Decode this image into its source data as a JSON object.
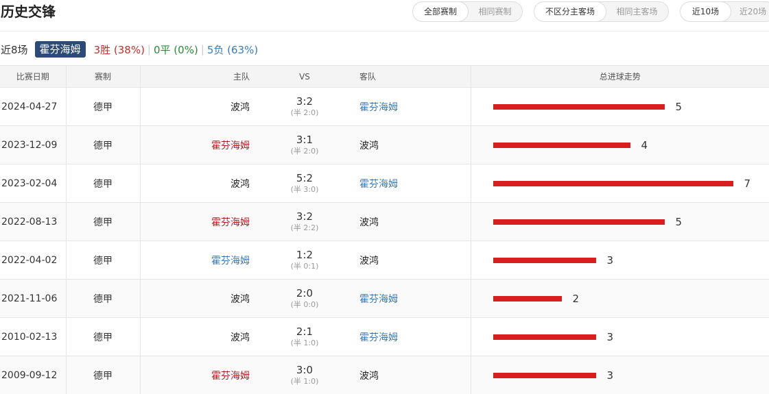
{
  "header": {
    "title": "历史交锋",
    "filters": [
      {
        "options": [
          "全部赛制",
          "相同赛制"
        ],
        "active": 0
      },
      {
        "options": [
          "不区分主客场",
          "相同主客场"
        ],
        "active": 0
      },
      {
        "options": [
          "近10场",
          "近20场"
        ],
        "active": 0
      }
    ]
  },
  "summary": {
    "near": "近8场",
    "team": "霍芬海姆",
    "win": "3胜 (38%)",
    "draw": "0平 (0%)",
    "lose": "5负 (63%)",
    "sep": "|"
  },
  "table": {
    "headers": [
      "比赛日期",
      "赛制",
      "主队",
      "VS",
      "客队",
      "总进球走势"
    ],
    "max_goals": 7,
    "rows": [
      {
        "date": "2024-04-27",
        "comp": "德甲",
        "home": "波鸿",
        "home_style": "plain",
        "score": "3:2",
        "half": "(半 2:0)",
        "away": "霍芬海姆",
        "away_style": "blue",
        "goals": 5
      },
      {
        "date": "2023-12-09",
        "comp": "德甲",
        "home": "霍芬海姆",
        "home_style": "red",
        "score": "3:1",
        "half": "(半 2:0)",
        "away": "波鸿",
        "away_style": "plain",
        "goals": 4
      },
      {
        "date": "2023-02-04",
        "comp": "德甲",
        "home": "波鸿",
        "home_style": "plain",
        "score": "5:2",
        "half": "(半 3:0)",
        "away": "霍芬海姆",
        "away_style": "blue",
        "goals": 7
      },
      {
        "date": "2022-08-13",
        "comp": "德甲",
        "home": "霍芬海姆",
        "home_style": "red",
        "score": "3:2",
        "half": "(半 2:2)",
        "away": "波鸿",
        "away_style": "plain",
        "goals": 5
      },
      {
        "date": "2022-04-02",
        "comp": "德甲",
        "home": "霍芬海姆",
        "home_style": "blue",
        "score": "1:2",
        "half": "(半 0:1)",
        "away": "波鸿",
        "away_style": "plain",
        "goals": 3
      },
      {
        "date": "2021-11-06",
        "comp": "德甲",
        "home": "波鸿",
        "home_style": "plain",
        "score": "2:0",
        "half": "(半 0:0)",
        "away": "霍芬海姆",
        "away_style": "blue",
        "goals": 2
      },
      {
        "date": "2010-02-13",
        "comp": "德甲",
        "home": "波鸿",
        "home_style": "plain",
        "score": "2:1",
        "half": "(半 1:0)",
        "away": "霍芬海姆",
        "away_style": "blue",
        "goals": 3
      },
      {
        "date": "2009-09-12",
        "comp": "德甲",
        "home": "霍芬海姆",
        "home_style": "red",
        "score": "3:0",
        "half": "(半 1:0)",
        "away": "波鸿",
        "away_style": "plain",
        "goals": 3
      }
    ]
  },
  "colors": {
    "bar": "#d81e1e",
    "team_tag": "#2b4a78",
    "win": "#c0302a",
    "draw": "#2a8a3a",
    "lose": "#3a7ab5"
  }
}
